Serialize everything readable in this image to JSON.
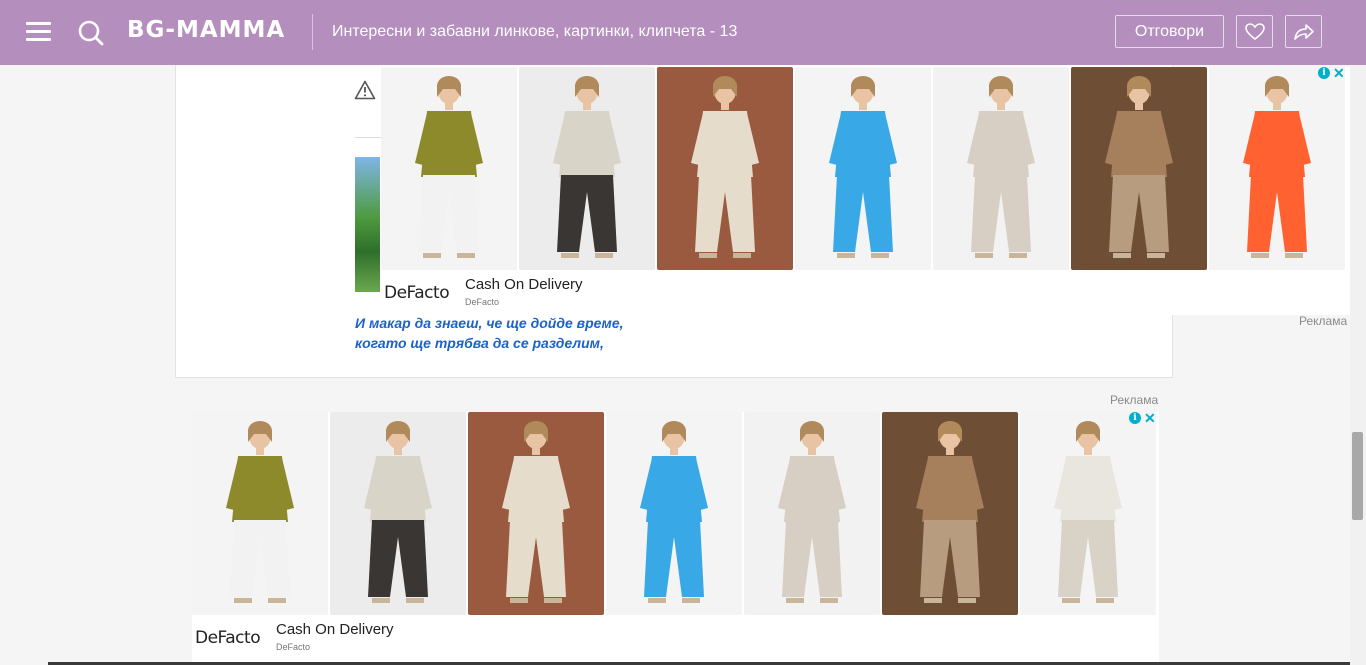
{
  "header": {
    "logo": "BG-MAMMA",
    "thread_title": "Интересни и забавни линкове, картинки, клипчета - 13",
    "reply_label": "Отговори"
  },
  "post": {
    "quote_lines": [
      "И макар да знаеш, че ще дойде време,",
      "когато ще трябва да се разделим,",
      "…"
    ]
  },
  "ad_label": "Реклама",
  "ads": [
    {
      "brand": "DeFacto",
      "headline": "Cash On Delivery",
      "advertiser": "DeFacto",
      "tiles": [
        {
          "name": "olive-blouse",
          "top": "#8c8a2a",
          "bottom": "#f2f2f2",
          "bg": "#f4f4f4"
        },
        {
          "name": "zebra-pants",
          "top": "#d9d4c8",
          "bottom": "#3a3633",
          "bg": "#ececec"
        },
        {
          "name": "beige-suit",
          "top": "#e6dccb",
          "bottom": "#e6dccb",
          "bg": "#9a5a40"
        },
        {
          "name": "blue-dress",
          "top": "#38a8e6",
          "bottom": "#38a8e6",
          "bg": "#f4f4f4"
        },
        {
          "name": "striped-dress",
          "top": "#d8cfc4",
          "bottom": "#d8cfc4",
          "bg": "#f2f2f2"
        },
        {
          "name": "brown-blazer",
          "top": "#a67f5c",
          "bottom": "#b89c7f",
          "bg": "#6e4e35"
        },
        {
          "name": "orange-dress",
          "top": "#ff6230",
          "bottom": "#ff6230",
          "bg": "#f4f4f4"
        }
      ]
    },
    {
      "brand": "DeFacto",
      "headline": "Cash On Delivery",
      "advertiser": "DeFacto",
      "tiles": [
        {
          "name": "olive-blouse",
          "top": "#8c8a2a",
          "bottom": "#f2f2f2",
          "bg": "#f4f4f4"
        },
        {
          "name": "zebra-pants",
          "top": "#d9d4c8",
          "bottom": "#3a3633",
          "bg": "#ececec"
        },
        {
          "name": "beige-suit",
          "top": "#e6dccb",
          "bottom": "#e6dccb",
          "bg": "#9a5a40"
        },
        {
          "name": "blue-dress",
          "top": "#38a8e6",
          "bottom": "#38a8e6",
          "bg": "#f4f4f4"
        },
        {
          "name": "striped-dress",
          "top": "#d8cfc4",
          "bottom": "#d8cfc4",
          "bg": "#f2f2f2"
        },
        {
          "name": "brown-blazer",
          "top": "#a67f5c",
          "bottom": "#b89c7f",
          "bg": "#6e4e35"
        },
        {
          "name": "printed-shirt",
          "top": "#e8e6df",
          "bottom": "#d8d3c6",
          "bg": "#f4f4f4"
        }
      ]
    }
  ],
  "colors": {
    "header_bg": "#b48ebd",
    "quote_text": "#1b63c6",
    "adchoices": "#00aecd"
  }
}
